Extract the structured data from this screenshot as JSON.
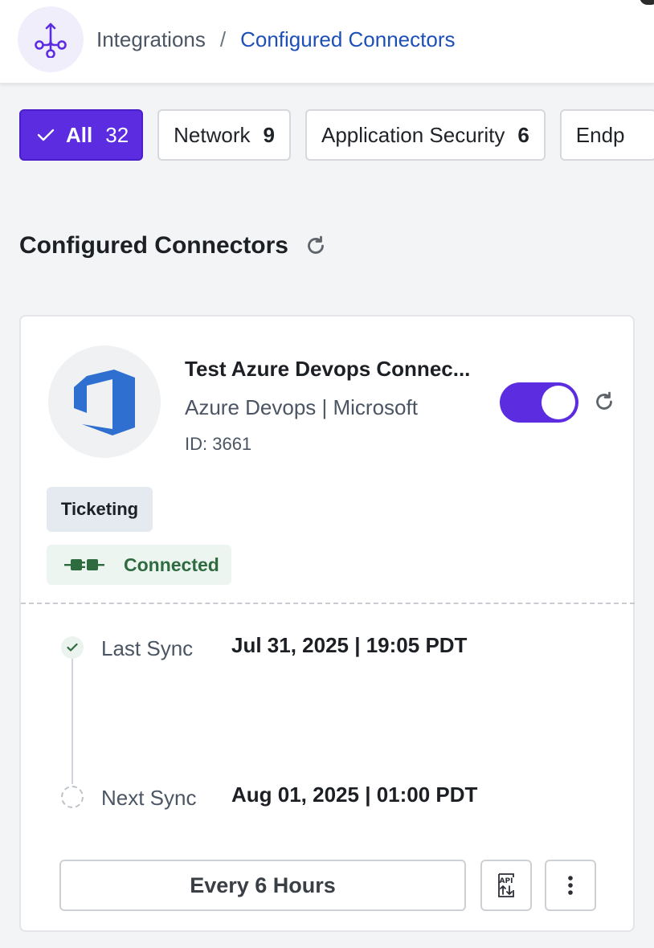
{
  "header": {
    "breadcrumb": {
      "root": "Integrations",
      "separator": "/",
      "current": "Configured Connectors"
    },
    "logo_icon": "integration-hub-icon"
  },
  "filters": [
    {
      "label": "All",
      "count": "32",
      "active": true
    },
    {
      "label": "Network",
      "count": "9",
      "active": false
    },
    {
      "label": "Application Security",
      "count": "6",
      "active": false
    },
    {
      "label": "Endp",
      "count": "",
      "active": false
    }
  ],
  "section": {
    "title": "Configured Connectors",
    "refresh_icon": "refresh-icon"
  },
  "connector": {
    "name": "Test Azure Devops Connec...",
    "vendor": "Azure Devops | Microsoft",
    "id": "ID: 3661",
    "enabled": true,
    "category": "Ticketing",
    "status": "Connected",
    "status_icon": "plug-icon",
    "last_sync": {
      "label": "Last Sync",
      "value": "Jul 31, 2025 | 19:05 PDT"
    },
    "next_sync": {
      "label": "Next Sync",
      "value": "Aug 01, 2025 | 01:00 PDT"
    },
    "frequency": "Every 6 Hours",
    "logo_icon": "azure-devops-icon"
  },
  "colors": {
    "accent": "#5b2ce0",
    "link": "#1d4fb8",
    "connected": "#2e6b3f",
    "azure": "#2f6fd0"
  }
}
